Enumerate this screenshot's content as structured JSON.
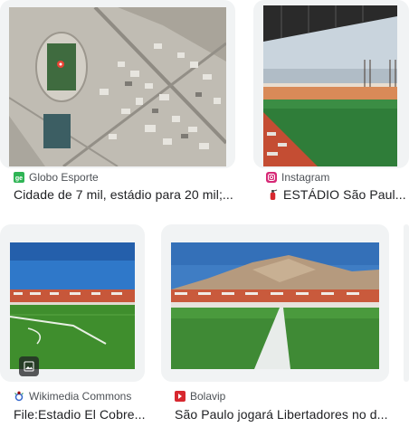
{
  "results": [
    {
      "source": "Globo Esporte",
      "title": "Cidade de 7 mil, estádio para 20 mil;...",
      "favicon": "globo-esporte-icon"
    },
    {
      "source": "Instagram",
      "title": "ESTÁDIO São Paul...",
      "favicon": "instagram-icon"
    },
    {
      "source": "Wikimedia Commons",
      "title": "File:Estadio El Cobre...",
      "favicon": "wikimedia-icon"
    },
    {
      "source": "Bolavip",
      "title": "São Paulo jogará Libertadores no d...",
      "favicon": "bolavip-icon"
    }
  ],
  "colors": {
    "globo_green": "#2fb455",
    "instagram": "#d62976",
    "bolavip": "#d7282f",
    "wikimedia": "#3366cc",
    "title_text": "#202124",
    "source_text": "#4d5156"
  }
}
